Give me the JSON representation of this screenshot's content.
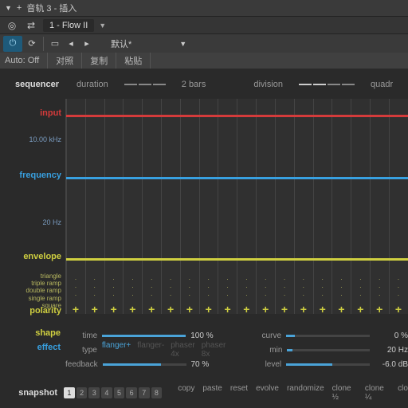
{
  "titlebar": {
    "title": "音轨 3 - 插入"
  },
  "preset": {
    "name": "1 - Flow II",
    "menu_label": "默认*"
  },
  "toolbar4": {
    "auto": "Auto: Off",
    "b": "对照",
    "c": "复制",
    "d": "粘贴"
  },
  "sequencer": {
    "label": "sequencer",
    "duration_label": "duration",
    "duration_val": "2 bars",
    "division_label": "division",
    "division_val": "quadr"
  },
  "tracks": {
    "input": {
      "label": "input",
      "color": "#d43b3b"
    },
    "freq": {
      "label": "frequency",
      "color": "#38a0e0",
      "hi": "10.00 kHz",
      "lo": "20 Hz"
    },
    "env": {
      "label": "envelope",
      "color": "#cfcf40",
      "shapes": [
        "triangle",
        "triple ramp",
        "double ramp",
        "single ramp",
        "square"
      ]
    },
    "polarity": {
      "label": "polarity"
    }
  },
  "shape": {
    "label": "shape",
    "time": {
      "name": "time",
      "val": "100 %",
      "fill": 100
    },
    "curve": {
      "name": "curve",
      "val": "0 %",
      "fill": 10
    }
  },
  "effect": {
    "label": "effect",
    "type": {
      "name": "type",
      "opts": [
        "flanger+",
        "flanger-",
        "phaser 4x",
        "phaser 8x"
      ],
      "active": 0
    },
    "feedback": {
      "name": "feedback",
      "val": "70 %",
      "fill": 70
    },
    "min": {
      "name": "min",
      "val": "20 Hz",
      "fill": 6
    },
    "level": {
      "name": "level",
      "val": "-6.0 dB",
      "fill": 55
    }
  },
  "snapshot": {
    "label": "snapshot",
    "buttons": [
      "1",
      "2",
      "3",
      "4",
      "5",
      "6",
      "7",
      "8"
    ],
    "actions": [
      "copy",
      "paste",
      "reset",
      "evolve",
      "randomize",
      "clone ½",
      "clone ¼",
      "clo"
    ]
  }
}
